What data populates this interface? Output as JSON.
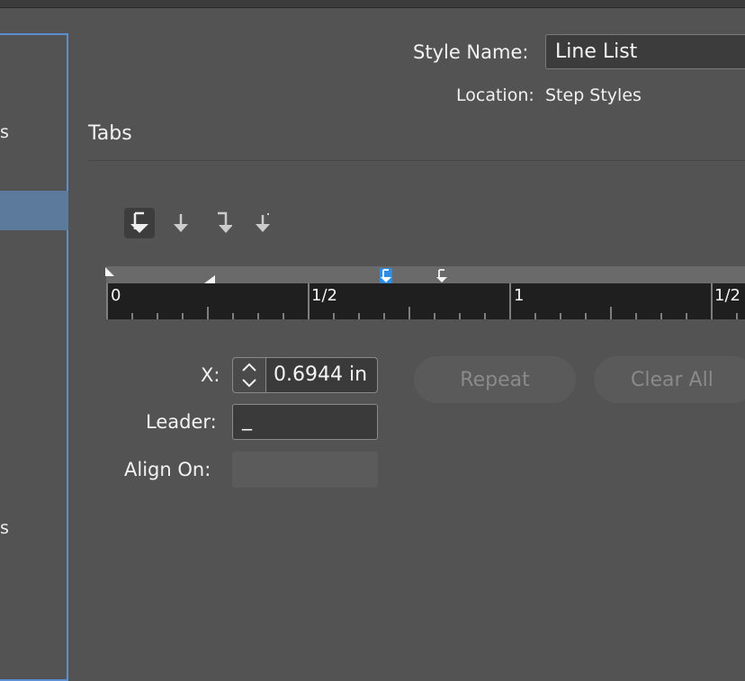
{
  "sidebar": {
    "items": [
      {
        "label": "s"
      },
      {
        "label": "s"
      }
    ]
  },
  "header": {
    "style_name_label": "Style Name:",
    "style_name_value": "Line List",
    "location_label": "Location:",
    "location_value": "Step Styles"
  },
  "section": {
    "title": "Tabs"
  },
  "tab_types": [
    {
      "icon": "left-justified-tab-icon",
      "active": true
    },
    {
      "icon": "center-justified-tab-icon",
      "active": false
    },
    {
      "icon": "right-justified-tab-icon",
      "active": false
    },
    {
      "icon": "align-on-character-tab-icon",
      "active": false
    }
  ],
  "ruler": {
    "labels": [
      "0",
      "1/2",
      "1",
      "1/2"
    ],
    "selected_tab_color": "#2d8ee8"
  },
  "fields": {
    "x_label": "X:",
    "x_value": "0.6944 in",
    "leader_label": "Leader:",
    "leader_value": "_",
    "align_on_label": "Align On:",
    "align_on_value": ""
  },
  "buttons": {
    "repeat": "Repeat",
    "clear_all": "Clear All"
  }
}
